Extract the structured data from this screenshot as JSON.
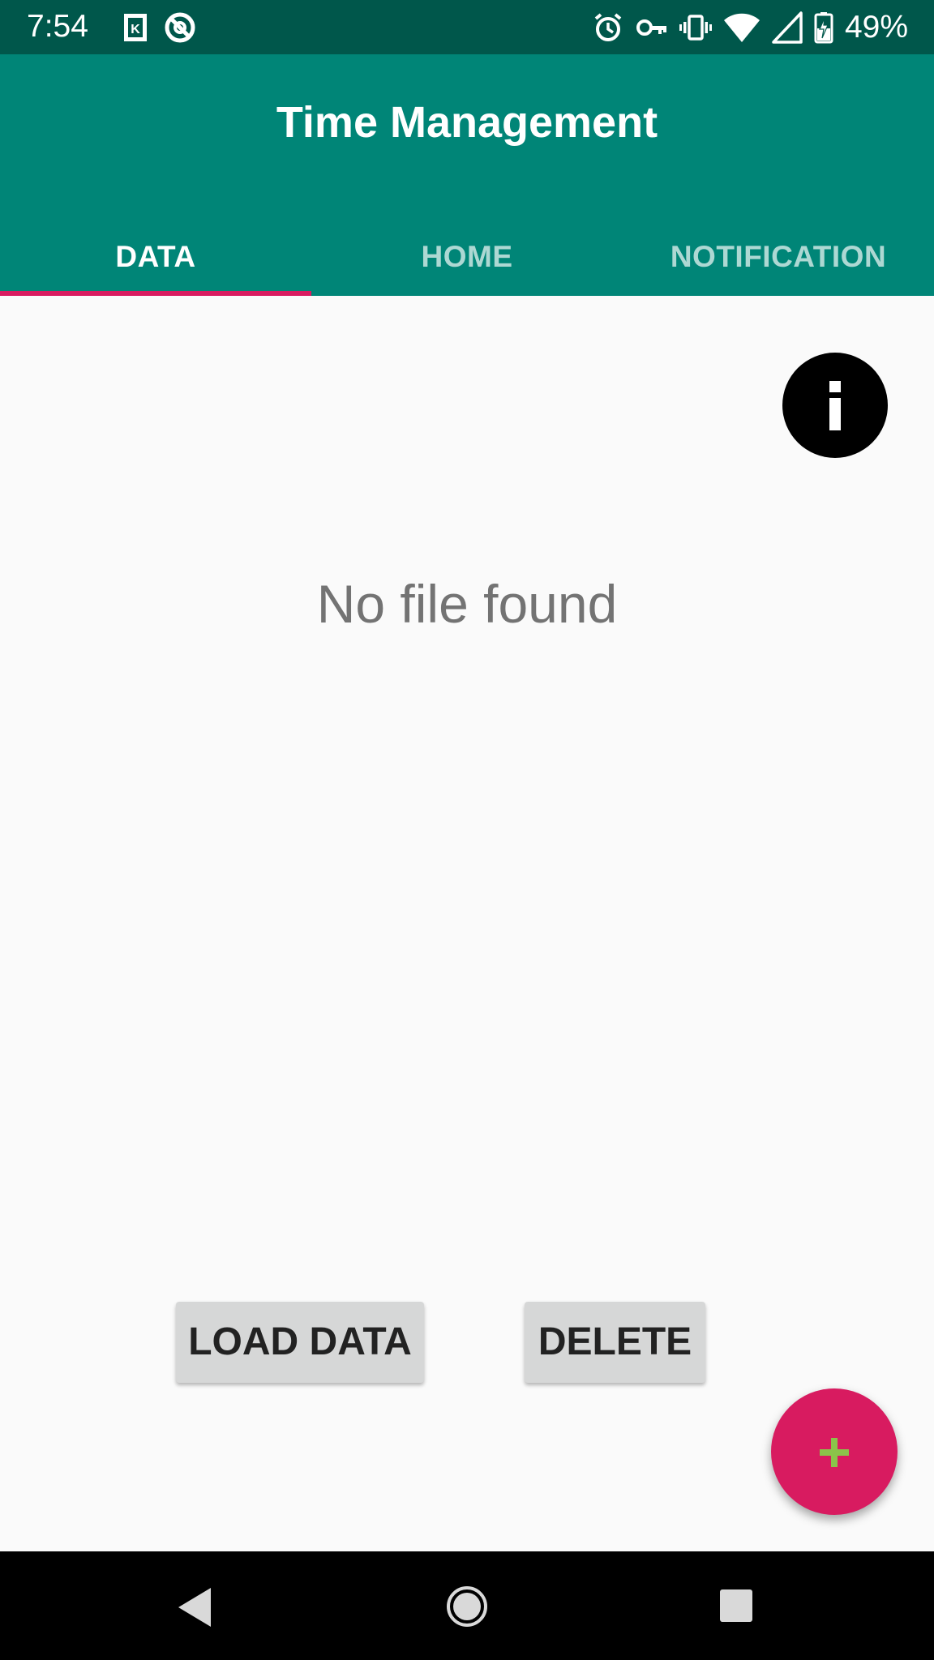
{
  "status_bar": {
    "time": "7:54",
    "battery_percent": "49%",
    "icons": [
      "k-notification-icon",
      "no-disturb-icon",
      "alarm-icon",
      "vpn-key-icon",
      "vibrate-icon",
      "wifi-icon",
      "signal-icon",
      "battery-charging-icon"
    ]
  },
  "app_bar": {
    "title": "Time Management"
  },
  "tabs": [
    {
      "label": "DATA",
      "selected": true
    },
    {
      "label": "HOME",
      "selected": false
    },
    {
      "label": "NOTIFICATION",
      "selected": false
    }
  ],
  "main": {
    "info_icon": "info-icon",
    "empty_message": "No file found",
    "load_button_label": "LOAD DATA",
    "delete_button_label": "DELETE"
  },
  "fab": {
    "icon": "plus-icon",
    "plus_color": "#8bc34a"
  },
  "navigation": {
    "icons": [
      "back-icon",
      "home-icon",
      "recents-icon"
    ]
  },
  "colors": {
    "primary": "#008577",
    "primary_dark": "#00574b",
    "accent": "#d81b60"
  }
}
